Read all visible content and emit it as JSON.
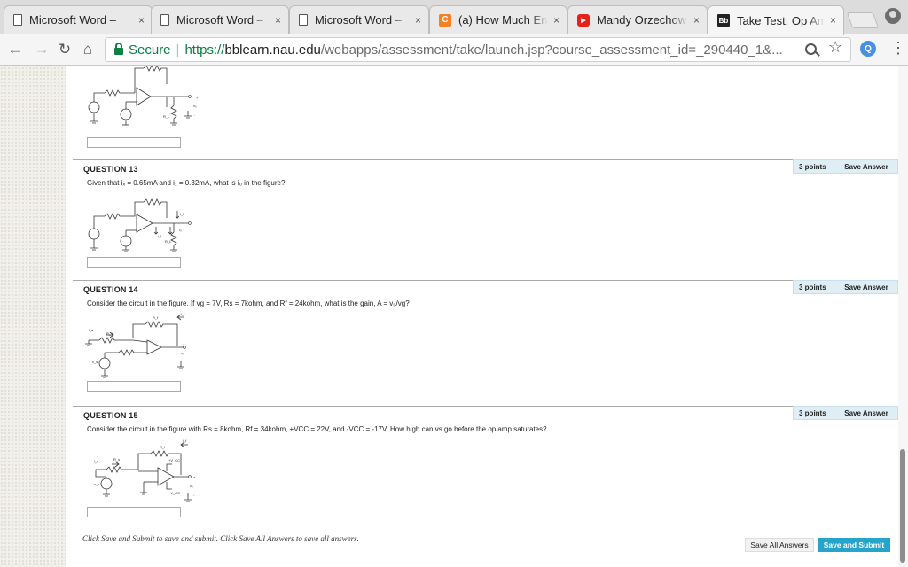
{
  "browser": {
    "tabs": [
      {
        "icon": "document-icon",
        "title": "Microsoft Word – ",
        "active": false
      },
      {
        "icon": "document-icon",
        "title": "Microsoft Word – ",
        "active": false
      },
      {
        "icon": "document-icon",
        "title": "Microsoft Word – ",
        "active": false
      },
      {
        "icon": "chegg-icon",
        "icon_text": "C",
        "title": "(a) How Much Ene",
        "active": false
      },
      {
        "icon": "youtube-icon",
        "icon_text": "▶",
        "title": "Mandy Orzechow",
        "active": false
      },
      {
        "icon": "blackboard-icon",
        "icon_text": "Bb",
        "title": "Take Test: Op Am",
        "active": true
      }
    ],
    "close_glyph": "×",
    "nav": {
      "back": "←",
      "forward": "→",
      "reload": "↻",
      "home": "⌂"
    },
    "address": {
      "secure_label": "Secure",
      "separator": "|",
      "scheme": "https://",
      "host": "bblearn.nau.edu",
      "path": "/webapps/assessment/take/launch.jsp?course_assessment_id=_290440_1&..."
    },
    "star": "☆",
    "extension_letter": "Q",
    "menu": "⋮"
  },
  "questions": [
    {
      "number_label": "QUESTION 13",
      "points": "3 points",
      "save_label": "Save Answer",
      "text": "Given that iₓ = 0.65mA and i₁ = 0.32mA, what is i₀ in the figure?"
    },
    {
      "number_label": "QUESTION 14",
      "points": "3 points",
      "save_label": "Save Answer",
      "text": "Consider the circuit in the figure. If vg = 7V, Rs = 7kohm, and Rf = 24kohm, what is the gain, A = v₀/vg?"
    },
    {
      "number_label": "QUESTION 15",
      "points": "3 points",
      "save_label": "Save Answer",
      "text": "Consider the circuit in the figure with Rs = 8kohm, Rf = 34kohm, +VCC = 22V, and -VCC = -17V. How high can vs go before the op amp saturates?"
    }
  ],
  "circuit_labels": {
    "plus": "+",
    "minus": "-",
    "vo": "v₀",
    "rl": "R_L",
    "if": "i_f",
    "il": "i_L",
    "io": "i₀",
    "rf": "R_f",
    "rs": "R_s",
    "is": "i_s",
    "vs": "v_s",
    "vcc_pos": "+V_CC",
    "vcc_neg": "−V_CC"
  },
  "footer": {
    "hint": "Click Save and Submit to save and submit. Click Save All Answers to save all answers.",
    "save_all_label": "Save All Answers",
    "save_submit_label": "Save and Submit"
  }
}
